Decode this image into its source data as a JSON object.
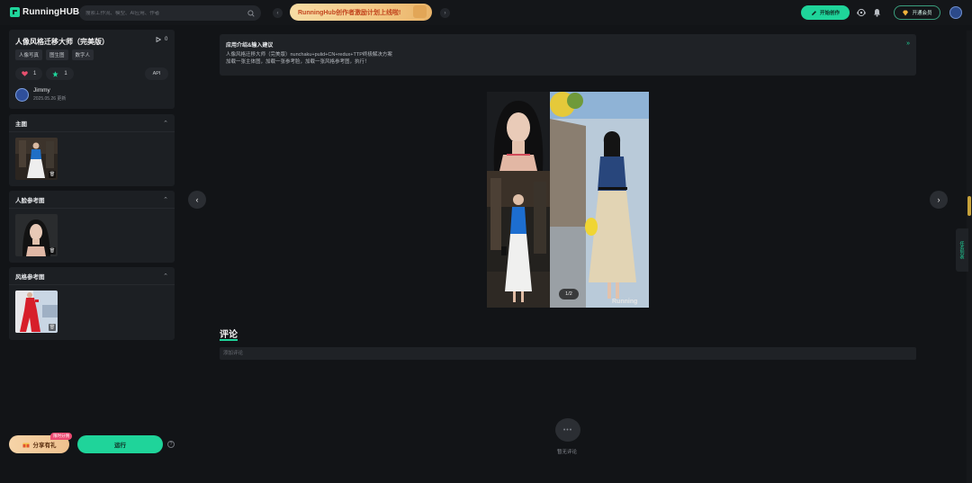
{
  "header": {
    "logo": "RunningHUB",
    "search_placeholder": "搜索工作流、模型、AI应用、作者",
    "banner": "RunningHub创作者激励计划上线啦!",
    "create_button": "开始创作",
    "vip_button": "开通会员"
  },
  "app": {
    "title": "人像风格迁移大师（完美版）",
    "views": "0",
    "tags": [
      "人像写真",
      "图生图",
      "数字人"
    ],
    "likes": "1",
    "favorites": "1",
    "api_label": "API",
    "author": "Jimmy",
    "updated": "2025.05.26 更新"
  },
  "inputs": [
    {
      "title": "主图"
    },
    {
      "title": "人脸参考图"
    },
    {
      "title": "风格参考图"
    }
  ],
  "actions": {
    "share": "分享有礼",
    "share_badge": "限时分佣",
    "run": "运行"
  },
  "intro": {
    "title": "应用介绍&输入建议",
    "line1": "人像风格迁移大师（完美版）nunchaku+pulid+CN+redux+TTP终极解决方案",
    "line2": "加载一张主体图，加载一张参考脸，加载一张风格参考图，执行！"
  },
  "preview": {
    "pager": "1/2",
    "watermark": "Running"
  },
  "comments": {
    "title": "评论",
    "placeholder": "添加评论",
    "empty": "暂无评论"
  },
  "side_tab": "任务列表",
  "colors": {
    "accent": "#1fd49a",
    "background": "#121417",
    "panel": "#1c1f23"
  }
}
